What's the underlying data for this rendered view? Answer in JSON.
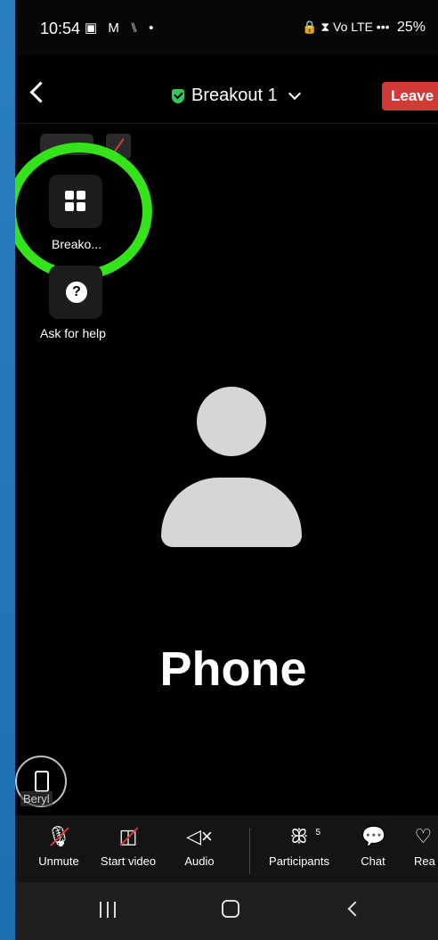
{
  "statusbar": {
    "time": "10:54",
    "left_icons": "▣ M ⑊ •",
    "signal": "🔒 ⧗ Vo LTE •••",
    "battery": "25%"
  },
  "header": {
    "title": "Breakout 1",
    "leave_label": "Leave"
  },
  "side_buttons": {
    "breakout_label": "Breako...",
    "help_icon": "?",
    "help_label": "Ask for help"
  },
  "participant": {
    "display_name": "Phone",
    "self_tag": "Beryl"
  },
  "toolbar": {
    "unmute_label": "Unmute",
    "start_video_label": "Start video",
    "audio_label": "Audio",
    "participants_label": "Participants",
    "participants_count": "5",
    "chat_label": "Chat",
    "reactions_label": "Rea"
  },
  "colors": {
    "leave": "#d23a35",
    "highlight_ring": "#35e31a",
    "shield": "#34c759",
    "background_gradient": "#2a7fbf"
  }
}
